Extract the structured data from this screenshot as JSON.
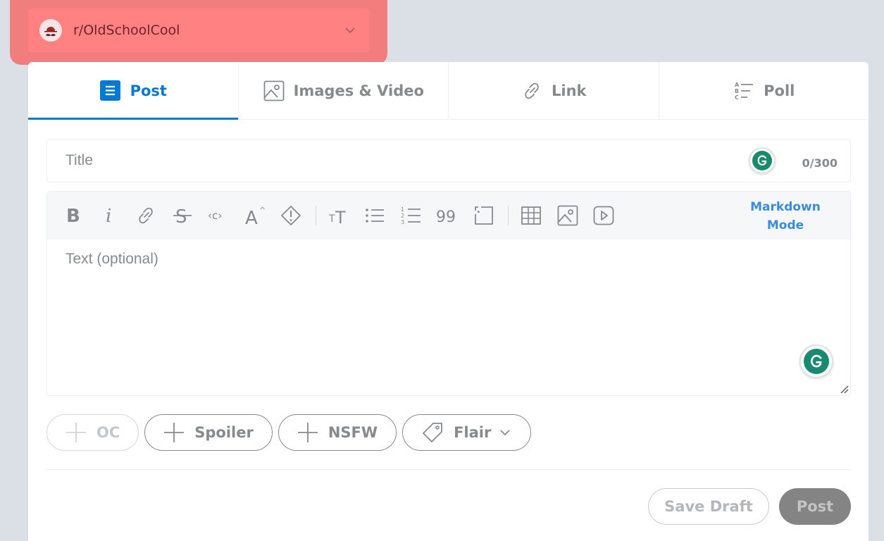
{
  "community": {
    "name": "r/OldSchoolCool",
    "avatar_icon": "mustache-hat-icon",
    "highlight_color": "#f17d7d"
  },
  "tabs": [
    {
      "label": "Post",
      "icon": "post-icon",
      "active": true
    },
    {
      "label": "Images & Video",
      "icon": "image-icon",
      "active": false
    },
    {
      "label": "Link",
      "icon": "link-icon",
      "active": false
    },
    {
      "label": "Poll",
      "icon": "poll-icon",
      "active": false
    }
  ],
  "title_field": {
    "placeholder": "Title",
    "value": "",
    "counter": "0/300"
  },
  "toolbar": {
    "buttons": [
      "bold-icon",
      "italic-icon",
      "link-icon",
      "strikethrough-icon",
      "inline-code-icon",
      "superscript-icon",
      "spoiler-icon",
      "heading-icon",
      "bulleted-list-icon",
      "numbered-list-icon",
      "quote-block-icon",
      "code-block-icon",
      "table-icon",
      "image-icon",
      "video-icon"
    ],
    "markdown_mode": "Markdown Mode"
  },
  "body_field": {
    "placeholder": "Text (optional)",
    "value": ""
  },
  "tags": {
    "oc": "OC",
    "spoiler": "Spoiler",
    "nsfw": "NSFW",
    "flair": "Flair"
  },
  "actions": {
    "save_draft": "Save Draft",
    "post": "Post"
  },
  "colors": {
    "accent": "#0079d3",
    "grammarly": "#1a8a6e"
  }
}
